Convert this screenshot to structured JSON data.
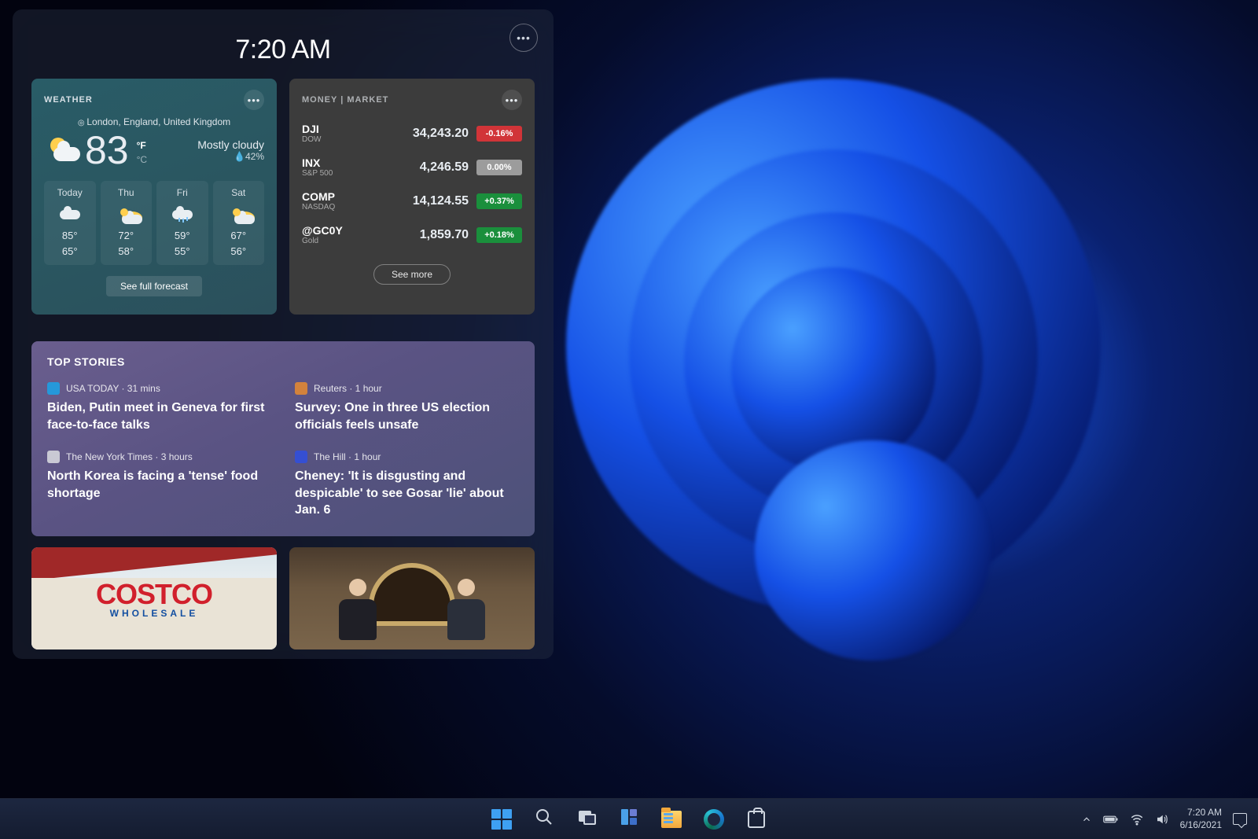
{
  "panel": {
    "time": "7:20 AM"
  },
  "weather": {
    "title": "WEATHER",
    "location": "London, England, United Kingdom",
    "temp": "83",
    "unit_f": "°F",
    "unit_c": "°C",
    "condition": "Mostly cloudy",
    "humidity": "💧42%",
    "forecast": [
      {
        "day": "Today",
        "hi": "85°",
        "lo": "65°",
        "kind": "cloud"
      },
      {
        "day": "Thu",
        "hi": "72°",
        "lo": "58°",
        "kind": "suncloud"
      },
      {
        "day": "Fri",
        "hi": "59°",
        "lo": "55°",
        "kind": "rain"
      },
      {
        "day": "Sat",
        "hi": "67°",
        "lo": "56°",
        "kind": "suncloud"
      }
    ],
    "see_full": "See full forecast"
  },
  "money": {
    "title": "MONEY | MARKET",
    "rows": [
      {
        "sym": "DJI",
        "sub": "DOW",
        "price": "34,243.20",
        "chg": "-0.16%",
        "dir": "down"
      },
      {
        "sym": "INX",
        "sub": "S&P 500",
        "price": "4,246.59",
        "chg": "0.00%",
        "dir": "flat"
      },
      {
        "sym": "COMP",
        "sub": "NASDAQ",
        "price": "14,124.55",
        "chg": "+0.37%",
        "dir": "up"
      },
      {
        "sym": "@GC0Y",
        "sub": "Gold",
        "price": "1,859.70",
        "chg": "+0.18%",
        "dir": "up"
      }
    ],
    "see_more": "See more"
  },
  "stories": {
    "title": "TOP STORIES",
    "items": [
      {
        "source": "USA TODAY",
        "time": "31 mins",
        "color": "#1aa3e8",
        "headline": "Biden, Putin meet in Geneva for first face-to-face talks"
      },
      {
        "source": "Reuters",
        "time": "1 hour",
        "color": "#e88b2f",
        "headline": "Survey: One in three US election officials feels unsafe"
      },
      {
        "source": "The New York Times",
        "time": "3 hours",
        "color": "#dcdde2",
        "headline": "North Korea is facing a 'tense' food shortage"
      },
      {
        "source": "The Hill",
        "time": "1 hour",
        "color": "#2f4fe0",
        "headline": "Cheney: 'It is disgusting and despicable' to see Gosar 'lie' about Jan. 6"
      }
    ]
  },
  "img_tiles": {
    "costco_logo": "COSTCO",
    "costco_sub": "WHOLESALE"
  },
  "taskbar": {
    "time": "7:20 AM",
    "date": "6/16/2021"
  }
}
